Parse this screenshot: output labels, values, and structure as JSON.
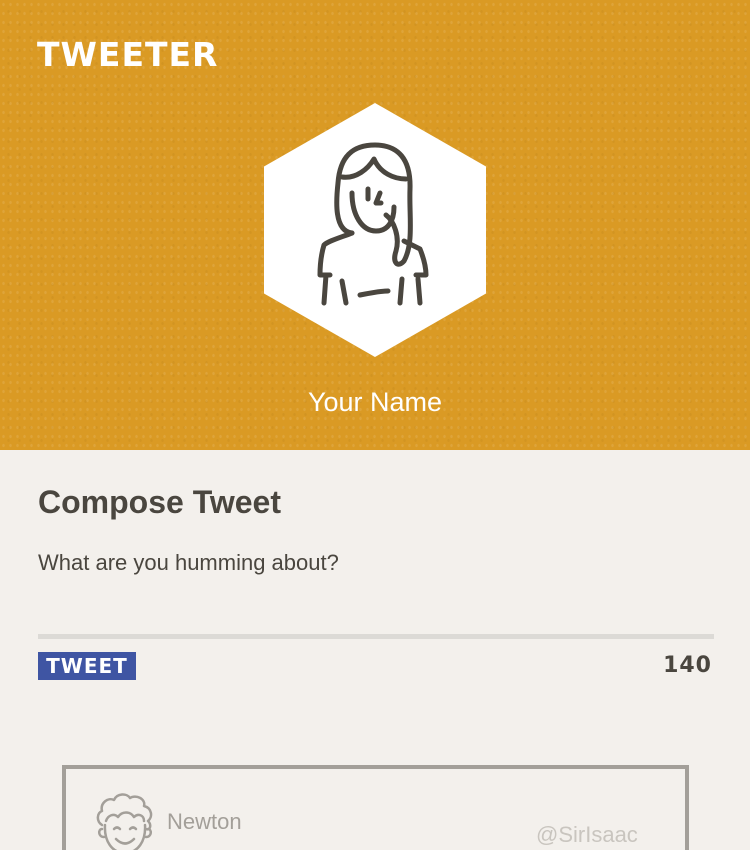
{
  "app": {
    "logo": "TWEETER"
  },
  "profile": {
    "name": "Your Name",
    "avatar_icon": "woman-avatar-icon"
  },
  "compose": {
    "title": "Compose Tweet",
    "placeholder": "What are you humming about?",
    "value": "",
    "tweet_button_label": "TWEET",
    "char_count": "140"
  },
  "feed": {
    "tweets": [
      {
        "name": "Newton",
        "handle": "@SirIsaac",
        "avatar_icon": "curly-hair-man-avatar-icon"
      }
    ]
  },
  "colors": {
    "header_bg": "#da9a24",
    "page_bg": "#f3f0ec",
    "text": "#4a463f",
    "button_bg": "#3f55a3",
    "card_border": "#a39f99"
  }
}
